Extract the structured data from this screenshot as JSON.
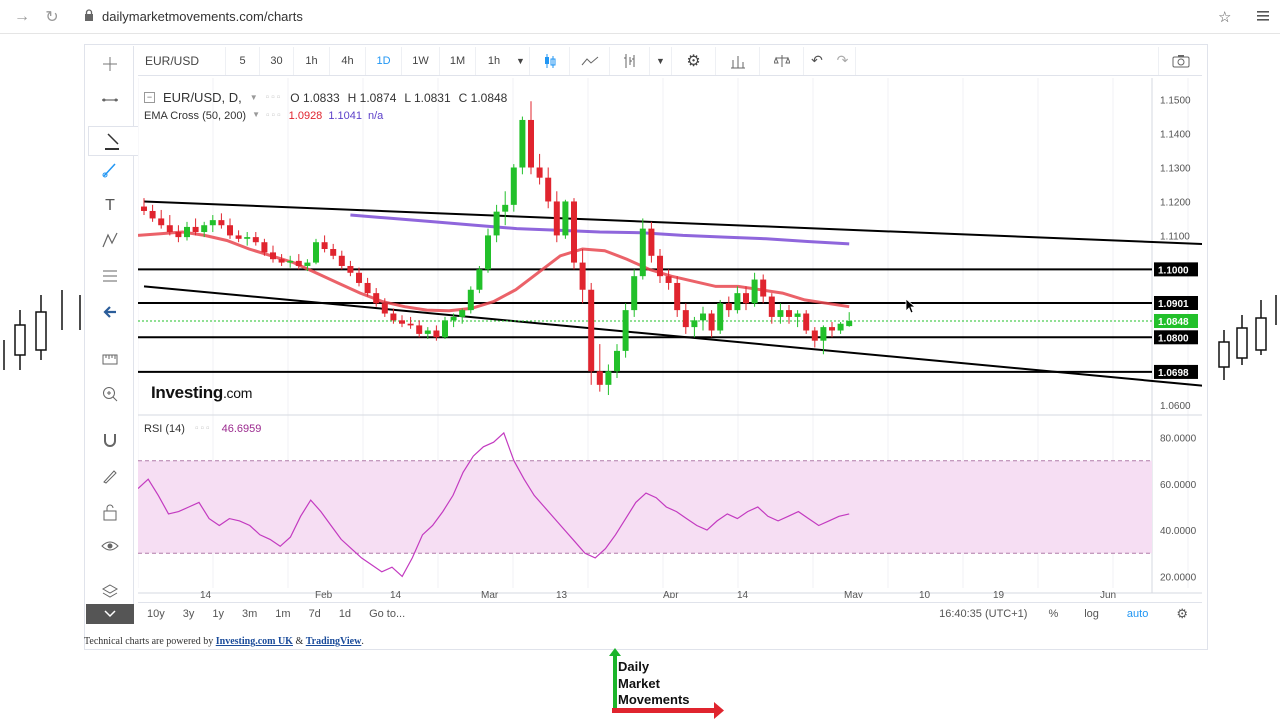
{
  "browser": {
    "url": "dailymarketmovements.com/charts"
  },
  "toolbar": {
    "symbol": "EUR/USD",
    "intervals": [
      "5",
      "30",
      "1h",
      "4h",
      "1D",
      "1W",
      "1M",
      "1h"
    ],
    "active_interval": "1D"
  },
  "legend": {
    "title": "EUR/USD, D,",
    "open": "O 1.0833",
    "high": "H 1.0874",
    "low": "L 1.0831",
    "close": "C 1.0848",
    "ema_label": "EMA Cross (50, 200)",
    "ema_fast": "1.0928",
    "ema_slow": "1.1041",
    "ema_na": "n/a"
  },
  "rsi": {
    "label": "RSI (14)",
    "value": "46.6959"
  },
  "brand": {
    "name": "Investing",
    "suffix": ".com"
  },
  "bottombar": {
    "ranges": [
      "10y",
      "3y",
      "1y",
      "3m",
      "1m",
      "7d",
      "1d",
      "Go to..."
    ],
    "time": "16:40:35 (UTC+1)",
    "pct": "%",
    "log": "log",
    "auto": "auto"
  },
  "footer": {
    "prefix": "Technical charts are powered by ",
    "link1": "Investing.com UK",
    "amp": " & ",
    "link2": "TradingView",
    "suffix": "."
  },
  "logo": {
    "line1": "Daily",
    "line2": "Market",
    "line3": "Movements"
  },
  "colors": {
    "up": "#22c02a",
    "down": "#e0242e",
    "ema_fast": "#e8464f",
    "ema_slow": "#7b4bd6",
    "rsi": "#c33ac0",
    "rsi_band": "#f6def3",
    "accent": "#2196f3"
  },
  "chart_data": {
    "type": "candlestick",
    "symbol": "EUR/USD",
    "interval": "D",
    "x_ticks": [
      "14",
      "Feb",
      "14",
      "Mar",
      "13",
      "Apr",
      "14",
      "May",
      "10",
      "19",
      "Jun"
    ],
    "price_ticks": [
      "1.1500",
      "1.1400",
      "1.1300",
      "1.1200",
      "1.1100",
      "1.1000",
      "1.0901",
      "1.0848",
      "1.0800",
      "1.0698",
      "1.0600"
    ],
    "price_range": [
      1.058,
      1.154
    ],
    "highlighted_levels": [
      {
        "value": 1.1,
        "label": "1.1000"
      },
      {
        "value": 1.0901,
        "label": "1.0901"
      },
      {
        "value": 1.0848,
        "label": "1.0848",
        "current": true
      },
      {
        "value": 1.08,
        "label": "1.0800"
      },
      {
        "value": 1.0698,
        "label": "1.0698"
      }
    ],
    "trendlines": [
      {
        "from": [
          0,
          1.12
        ],
        "to": [
          145,
          1.105
        ]
      },
      {
        "from": [
          0,
          1.095
        ],
        "to": [
          145,
          1.06
        ]
      }
    ],
    "candles": [
      [
        1.1185,
        1.121,
        1.116,
        1.1172
      ],
      [
        1.1172,
        1.119,
        1.114,
        1.115
      ],
      [
        1.115,
        1.1175,
        1.112,
        1.113
      ],
      [
        1.113,
        1.116,
        1.11,
        1.111
      ],
      [
        1.111,
        1.113,
        1.108,
        1.1095
      ],
      [
        1.1095,
        1.114,
        1.1085,
        1.1125
      ],
      [
        1.1125,
        1.115,
        1.11,
        1.111
      ],
      [
        1.111,
        1.114,
        1.1095,
        1.113
      ],
      [
        1.113,
        1.116,
        1.111,
        1.1145
      ],
      [
        1.1145,
        1.1165,
        1.112,
        1.113
      ],
      [
        1.113,
        1.115,
        1.109,
        1.11
      ],
      [
        1.11,
        1.1115,
        1.108,
        1.109
      ],
      [
        1.109,
        1.111,
        1.107,
        1.1095
      ],
      [
        1.1095,
        1.111,
        1.107,
        1.108
      ],
      [
        1.108,
        1.109,
        1.104,
        1.105
      ],
      [
        1.105,
        1.107,
        1.102,
        1.103
      ],
      [
        1.103,
        1.1045,
        1.101,
        1.102
      ],
      [
        1.102,
        1.104,
        1.1005,
        1.1025
      ],
      [
        1.1025,
        1.1045,
        1.1,
        1.101
      ],
      [
        1.101,
        1.103,
        1.0995,
        1.102
      ],
      [
        1.102,
        1.109,
        1.1015,
        1.108
      ],
      [
        1.108,
        1.11,
        1.105,
        1.106
      ],
      [
        1.106,
        1.1075,
        1.103,
        1.104
      ],
      [
        1.104,
        1.1055,
        1.1,
        1.101
      ],
      [
        1.101,
        1.1025,
        1.098,
        1.099
      ],
      [
        1.099,
        1.1005,
        1.095,
        1.096
      ],
      [
        1.096,
        1.0975,
        1.092,
        1.093
      ],
      [
        1.093,
        1.0945,
        1.089,
        1.09
      ],
      [
        1.09,
        1.0915,
        1.086,
        1.087
      ],
      [
        1.087,
        1.0885,
        1.084,
        1.085
      ],
      [
        1.085,
        1.0865,
        1.083,
        1.084
      ],
      [
        1.084,
        1.086,
        1.0825,
        1.0835
      ],
      [
        1.0835,
        1.085,
        1.08,
        1.081
      ],
      [
        1.081,
        1.083,
        1.0795,
        1.082
      ],
      [
        1.082,
        1.0835,
        1.079,
        1.08
      ],
      [
        1.08,
        1.086,
        1.0795,
        1.085
      ],
      [
        1.085,
        1.087,
        1.083,
        1.086
      ],
      [
        1.086,
        1.0885,
        1.084,
        1.088
      ],
      [
        1.088,
        1.095,
        1.087,
        1.094
      ],
      [
        1.094,
        1.101,
        1.093,
        1.1
      ],
      [
        1.1,
        1.112,
        1.099,
        1.11
      ],
      [
        1.11,
        1.119,
        1.108,
        1.117
      ],
      [
        1.117,
        1.123,
        1.113,
        1.119
      ],
      [
        1.119,
        1.131,
        1.117,
        1.13
      ],
      [
        1.13,
        1.145,
        1.128,
        1.144
      ],
      [
        1.144,
        1.1495,
        1.128,
        1.13
      ],
      [
        1.13,
        1.134,
        1.125,
        1.127
      ],
      [
        1.127,
        1.13,
        1.118,
        1.12
      ],
      [
        1.12,
        1.123,
        1.108,
        1.11
      ],
      [
        1.11,
        1.1205,
        1.109,
        1.12
      ],
      [
        1.12,
        1.121,
        1.1,
        1.102
      ],
      [
        1.102,
        1.106,
        1.09,
        1.094
      ],
      [
        1.094,
        1.096,
        1.066,
        1.07
      ],
      [
        1.07,
        1.078,
        1.064,
        1.066
      ],
      [
        1.066,
        1.072,
        1.063,
        1.07
      ],
      [
        1.07,
        1.078,
        1.068,
        1.076
      ],
      [
        1.076,
        1.09,
        1.074,
        1.088
      ],
      [
        1.088,
        1.1,
        1.086,
        1.098
      ],
      [
        1.098,
        1.115,
        1.097,
        1.112
      ],
      [
        1.112,
        1.114,
        1.102,
        1.104
      ],
      [
        1.104,
        1.106,
        1.096,
        1.098
      ],
      [
        1.098,
        1.1,
        1.094,
        1.096
      ],
      [
        1.096,
        1.098,
        1.086,
        1.088
      ],
      [
        1.088,
        1.09,
        1.081,
        1.083
      ],
      [
        1.083,
        1.086,
        1.08,
        1.085
      ],
      [
        1.085,
        1.089,
        1.082,
        1.087
      ],
      [
        1.087,
        1.088,
        1.08,
        1.082
      ],
      [
        1.082,
        1.091,
        1.081,
        1.09
      ],
      [
        1.09,
        1.092,
        1.086,
        1.088
      ],
      [
        1.088,
        1.095,
        1.087,
        1.093
      ],
      [
        1.093,
        1.095,
        1.088,
        1.09
      ],
      [
        1.09,
        1.099,
        1.089,
        1.097
      ],
      [
        1.097,
        1.0985,
        1.09,
        1.092
      ],
      [
        1.092,
        1.093,
        1.084,
        1.086
      ],
      [
        1.086,
        1.09,
        1.084,
        1.088
      ],
      [
        1.088,
        1.0895,
        1.084,
        1.086
      ],
      [
        1.086,
        1.088,
        1.083,
        1.087
      ],
      [
        1.087,
        1.088,
        1.081,
        1.082
      ],
      [
        1.082,
        1.083,
        1.077,
        1.079
      ],
      [
        1.079,
        1.0835,
        1.075,
        1.083
      ],
      [
        1.083,
        1.0845,
        1.08,
        1.082
      ],
      [
        1.082,
        1.0845,
        1.081,
        1.084
      ],
      [
        1.0833,
        1.0874,
        1.0831,
        1.0848
      ]
    ],
    "ema_fast_series": [
      1.11,
      1.1105,
      1.111,
      1.11,
      1.1085,
      1.106,
      1.104,
      1.102,
      1.099,
      1.096,
      1.093,
      1.0905,
      1.089,
      1.088,
      1.0878,
      1.0885,
      1.0905,
      1.094,
      1.099,
      1.104,
      1.106,
      1.1055,
      1.103,
      1.1,
      1.098,
      1.0965,
      1.095,
      1.095,
      1.094,
      1.093,
      1.091,
      1.09,
      1.089
    ],
    "ema_slow_series": [
      1.116,
      1.115,
      1.114,
      1.113,
      1.112,
      1.1115,
      1.111,
      1.1108,
      1.11,
      1.1095,
      1.109,
      1.1082,
      1.1075
    ],
    "rsi_series": [
      58,
      62,
      55,
      47,
      48,
      50,
      52,
      45,
      42,
      45,
      44,
      42,
      38,
      36,
      33,
      37,
      46,
      53,
      48,
      42,
      36,
      32,
      28,
      25,
      22,
      24,
      20,
      28,
      38,
      42,
      48,
      55,
      65,
      72,
      76,
      78,
      82,
      70,
      62,
      55,
      50,
      45,
      40,
      35,
      30,
      28,
      32,
      38,
      45,
      52,
      56,
      54,
      50,
      48,
      45,
      42,
      40,
      44,
      47,
      45,
      48,
      50,
      46,
      44,
      46,
      48,
      45,
      42,
      44,
      46,
      47
    ],
    "rsi_range": [
      15,
      85
    ],
    "rsi_ticks": [
      "80.0000",
      "60.0000",
      "40.0000",
      "20.0000"
    ],
    "rsi_band": [
      30,
      70
    ]
  }
}
